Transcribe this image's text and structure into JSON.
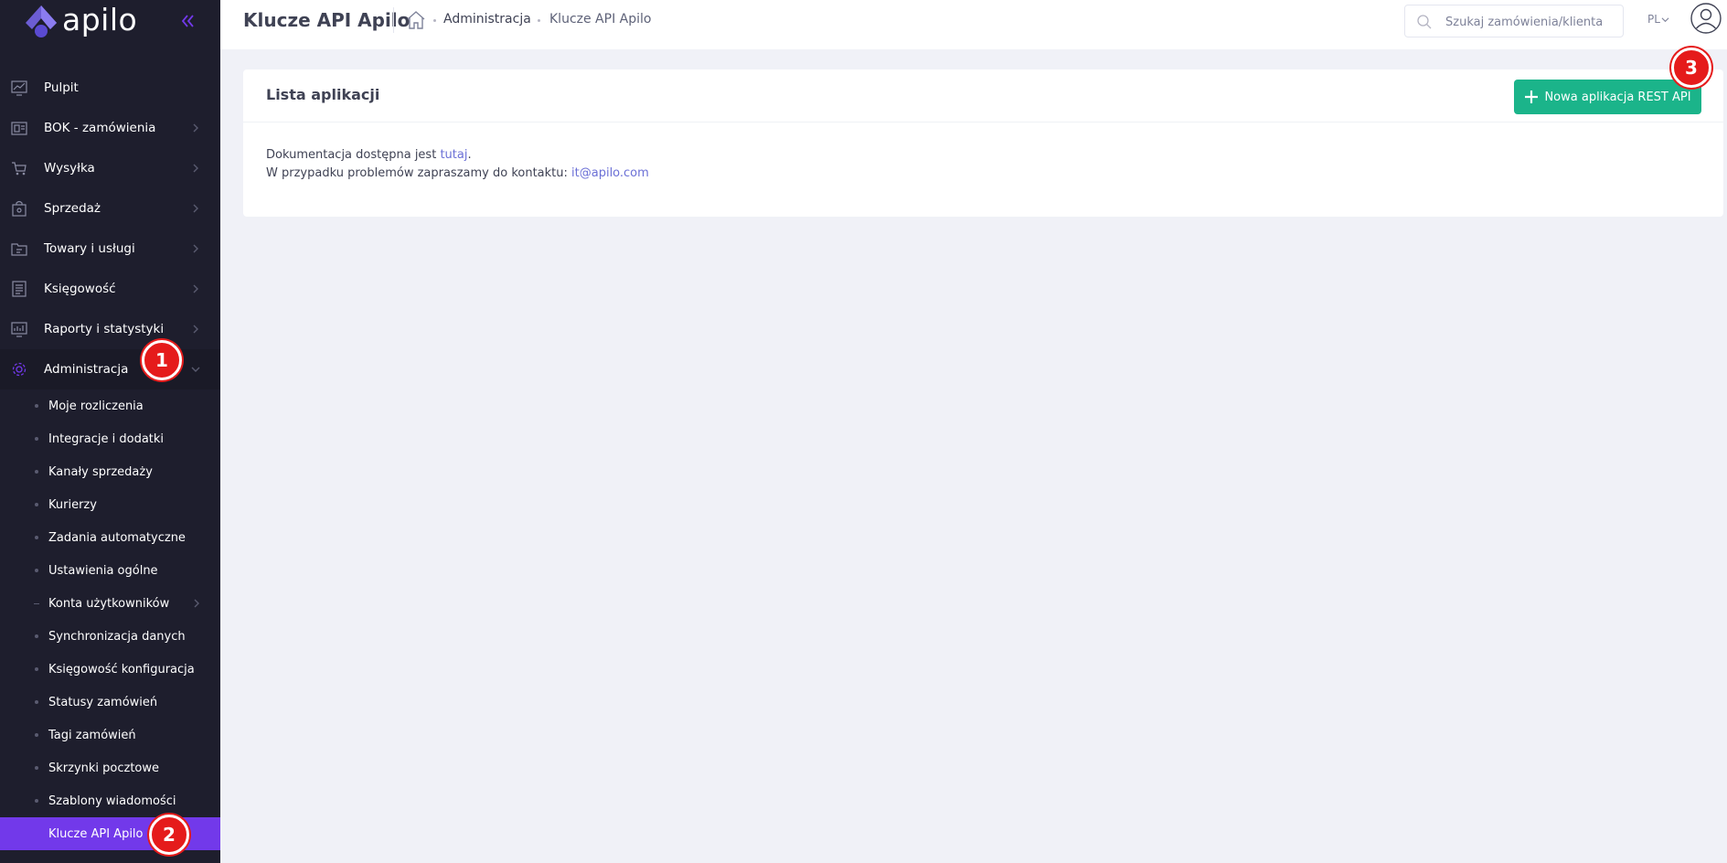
{
  "brand": {
    "name": "apilo"
  },
  "sidebar": {
    "menu": [
      {
        "label": "Pulpit",
        "icon": "dashboard-icon",
        "arrow": false
      },
      {
        "label": "BOK - zamówienia",
        "icon": "orders-icon",
        "arrow": true
      },
      {
        "label": "Wysyłka",
        "icon": "shipping-cart-icon",
        "arrow": true
      },
      {
        "label": "Sprzedaż",
        "icon": "sales-bag-icon",
        "arrow": true
      },
      {
        "label": "Towary i usługi",
        "icon": "products-icon",
        "arrow": true
      },
      {
        "label": "Księgowość",
        "icon": "accounting-list-icon",
        "arrow": true
      },
      {
        "label": "Raporty i statystyki",
        "icon": "reports-chart-icon",
        "arrow": true
      },
      {
        "label": "Administracja",
        "icon": "gear-icon",
        "arrow": true,
        "expanded": true
      }
    ],
    "submenu": [
      {
        "label": "Moje rozliczenia"
      },
      {
        "label": "Integracje i dodatki"
      },
      {
        "label": "Kanały sprzedaży"
      },
      {
        "label": "Kurierzy"
      },
      {
        "label": "Zadania automatyczne"
      },
      {
        "label": "Ustawienia ogólne"
      },
      {
        "label": "Konta użytkowników",
        "arrow": true
      },
      {
        "label": "Synchronizacja danych"
      },
      {
        "label": "Księgowość konfiguracja"
      },
      {
        "label": "Statusy zamówień"
      },
      {
        "label": "Tagi zamówień"
      },
      {
        "label": "Skrzynki pocztowe"
      },
      {
        "label": "Szablony wiadomości"
      },
      {
        "label": "Klucze API Apilo",
        "active": true
      }
    ]
  },
  "header": {
    "title": "Klucze API Apilo",
    "breadcrumb": [
      "Administracja",
      "Klucze API Apilo"
    ],
    "search_placeholder": "Szukaj zamówienia/klienta",
    "language": "PL"
  },
  "card": {
    "title": "Lista aplikacji",
    "new_button_label": "Nowa aplikacja REST API",
    "doc_text": "Dokumentacja dostępna jest ",
    "doc_link": "tutaj",
    "doc_suffix": ".",
    "contact_text": "W przypadku problemów zapraszamy do kontaktu: ",
    "contact_email": "it@apilo.com"
  },
  "badges": [
    "1",
    "2",
    "3"
  ],
  "colors": {
    "sidebar_bg": "#1e1e2d",
    "active_item": "#7239ea",
    "primary_button": "#1bb48a",
    "badge": "#e51b1b",
    "page_bg": "#f0f1f7"
  }
}
